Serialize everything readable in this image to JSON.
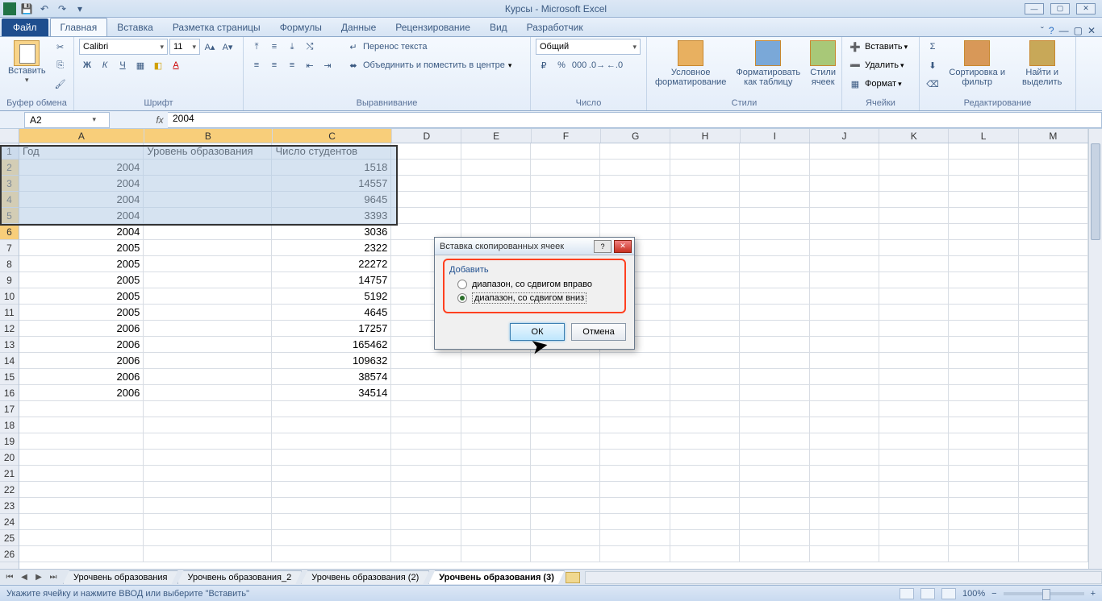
{
  "title": "Курсы - Microsoft Excel",
  "tabs": {
    "file": "Файл",
    "items": [
      "Главная",
      "Вставка",
      "Разметка страницы",
      "Формулы",
      "Данные",
      "Рецензирование",
      "Вид",
      "Разработчик"
    ],
    "active": 0
  },
  "ribbon": {
    "clipboard": {
      "paste": "Вставить",
      "label": "Буфер обмена"
    },
    "font": {
      "name": "Calibri",
      "size": "11",
      "label": "Шрифт"
    },
    "align": {
      "wrap": "Перенос текста",
      "merge": "Объединить и поместить в центре",
      "label": "Выравнивание"
    },
    "number": {
      "format": "Общий",
      "label": "Число"
    },
    "styles": {
      "cond": "Условное форматирование",
      "table": "Форматировать как таблицу",
      "cell": "Стили ячеек",
      "label": "Стили"
    },
    "cells": {
      "insert": "Вставить",
      "delete": "Удалить",
      "format": "Формат",
      "label": "Ячейки"
    },
    "edit": {
      "sort": "Сортировка и фильтр",
      "find": "Найти и выделить",
      "label": "Редактирование"
    }
  },
  "namebox": "A2",
  "formula": "2004",
  "columns": [
    "A",
    "B",
    "C",
    "D",
    "E",
    "F",
    "G",
    "H",
    "I",
    "J",
    "K",
    "L",
    "M"
  ],
  "headers": {
    "A": "Год",
    "B": "Уровень образования",
    "C": "Число студентов"
  },
  "rows": [
    {
      "n": 1,
      "A": "Год",
      "B": "Уровень образования",
      "C": "Число студентов",
      "hdr": true
    },
    {
      "n": 2,
      "A": "2004",
      "C": "1518"
    },
    {
      "n": 3,
      "A": "2004",
      "C": "14557"
    },
    {
      "n": 4,
      "A": "2004",
      "C": "9645"
    },
    {
      "n": 5,
      "A": "2004",
      "C": "3393"
    },
    {
      "n": 6,
      "A": "2004",
      "C": "3036"
    },
    {
      "n": 7,
      "A": "2005",
      "C": "2322"
    },
    {
      "n": 8,
      "A": "2005",
      "C": "22272"
    },
    {
      "n": 9,
      "A": "2005",
      "C": "14757"
    },
    {
      "n": 10,
      "A": "2005",
      "C": "5192"
    },
    {
      "n": 11,
      "A": "2005",
      "C": "4645"
    },
    {
      "n": 12,
      "A": "2006",
      "C": "17257"
    },
    {
      "n": 13,
      "A": "2006",
      "C": "165462"
    },
    {
      "n": 14,
      "A": "2006",
      "C": "109632"
    },
    {
      "n": 15,
      "A": "2006",
      "C": "38574"
    },
    {
      "n": 16,
      "A": "2006",
      "C": "34514"
    },
    {
      "n": 17
    },
    {
      "n": 18
    },
    {
      "n": 19
    },
    {
      "n": 20
    },
    {
      "n": 21
    },
    {
      "n": 22
    },
    {
      "n": 23
    },
    {
      "n": 24
    },
    {
      "n": 25
    },
    {
      "n": 26
    }
  ],
  "sheets": [
    "Урочвень образования",
    "Урочвень образования_2",
    "Урочвень образования (2)",
    "Урочвень образования (3)"
  ],
  "active_sheet": 3,
  "status": "Укажите ячейку и нажмите ВВОД или выберите \"Вставить\"",
  "zoom": "100%",
  "dialog": {
    "title": "Вставка скопированных ячеек",
    "group": "Добавить",
    "opt1": "диапазон, со сдвигом вправо",
    "opt2": "диапазон, со сдвигом вниз",
    "ok": "ОК",
    "cancel": "Отмена"
  }
}
